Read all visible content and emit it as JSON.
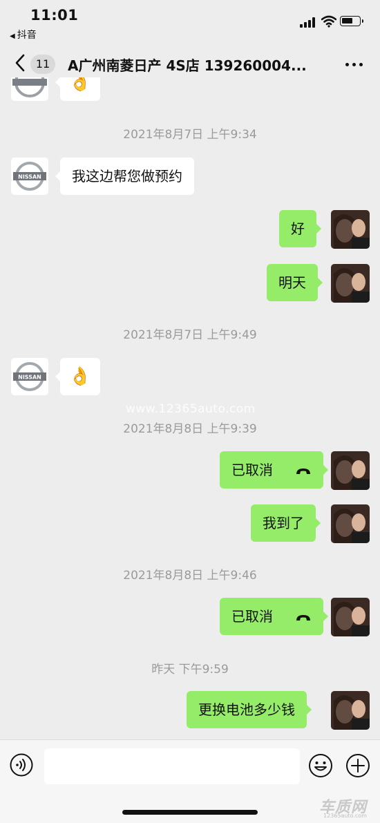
{
  "status_bar": {
    "time": "11:01",
    "back_app": "抖音"
  },
  "nav": {
    "unread_count": "11",
    "title": "A广州南菱日产 4S店 139260004..."
  },
  "messages": {
    "ts1": "2021年8月7日 上午9:34",
    "msg1": "我这边帮您做预约",
    "msg2": "好",
    "msg3": "明天",
    "ts2": "2021年8月7日 上午9:49",
    "msg4_emoji": "👌",
    "ts3": "2021年8月8日 上午9:39",
    "msg5": "已取消",
    "msg6": "我到了",
    "ts4": "2021年8月8日 上午9:46",
    "msg7": "已取消",
    "ts5": "昨天 下午9:59",
    "msg8": "更换电池多少钱"
  },
  "contact_logo_text": "NISSAN",
  "watermark": "www.12365auto.com",
  "site_logo": {
    "big": "车质网",
    "small": "12365auto.com"
  },
  "input": {
    "value": ""
  },
  "colors": {
    "background": "#ededed",
    "sent_bubble": "#95ec69",
    "received_bubble": "#ffffff"
  },
  "icons": [
    "back-chevron-icon",
    "more-dots-icon",
    "nissan-logo",
    "phone-hangup-icon",
    "voice-icon",
    "emoji-icon",
    "plus-icon",
    "ok-hand-icon"
  ]
}
